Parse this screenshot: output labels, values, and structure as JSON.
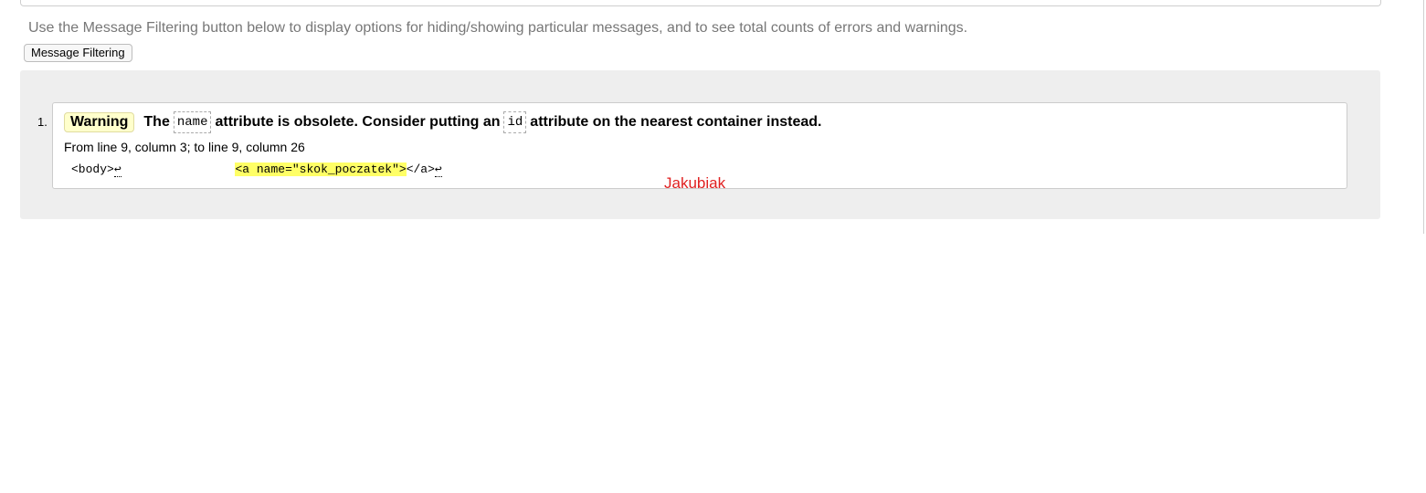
{
  "instructions": "Use the Message Filtering button below to display options for hiding/showing particular messages, and to see total counts of errors and warnings.",
  "filter_button_label": "Message Filtering",
  "messages": [
    {
      "number": "1.",
      "type_label": "Warning",
      "text_parts": {
        "part1": "The",
        "code1": "name",
        "part2": "attribute is obsolete. Consider putting an",
        "code2": "id",
        "part3": "attribute on the nearest container instead."
      },
      "location": "From line 9, column 3; to line 9, column 26",
      "extract": {
        "before": "<body>",
        "gap": "                ",
        "highlight": "<a name=\"skok_poczatek\">",
        "after": "</a>",
        "line_break_glyph": "↩"
      }
    }
  ],
  "watermark": "Jakubiak"
}
